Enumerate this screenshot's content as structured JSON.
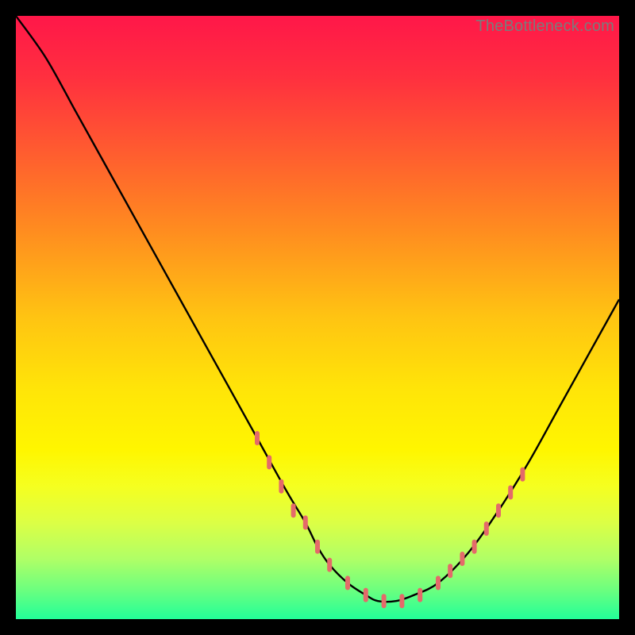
{
  "watermark": "TheBottleneck.com",
  "colors": {
    "gradient_stops": [
      {
        "offset": 0.0,
        "color": "#ff1749"
      },
      {
        "offset": 0.1,
        "color": "#ff2f3f"
      },
      {
        "offset": 0.22,
        "color": "#ff5a30"
      },
      {
        "offset": 0.35,
        "color": "#ff8a20"
      },
      {
        "offset": 0.5,
        "color": "#ffc412"
      },
      {
        "offset": 0.62,
        "color": "#ffe508"
      },
      {
        "offset": 0.72,
        "color": "#fff600"
      },
      {
        "offset": 0.78,
        "color": "#f5ff20"
      },
      {
        "offset": 0.84,
        "color": "#dcff45"
      },
      {
        "offset": 0.9,
        "color": "#b0ff66"
      },
      {
        "offset": 0.95,
        "color": "#6eff7e"
      },
      {
        "offset": 1.0,
        "color": "#22ff99"
      }
    ],
    "curve": "#000000",
    "marker": "#e46a6a",
    "frame_bg": "#000000"
  },
  "chart_data": {
    "type": "line",
    "title": "",
    "xlabel": "",
    "ylabel": "",
    "xlim": [
      0,
      100
    ],
    "ylim": [
      0,
      100
    ],
    "grid": false,
    "legend": false,
    "series": [
      {
        "name": "bottleneck-curve",
        "x": [
          0,
          5,
          10,
          15,
          20,
          25,
          30,
          35,
          40,
          45,
          48,
          50,
          52,
          55,
          58,
          60,
          63,
          66,
          70,
          75,
          80,
          85,
          90,
          95,
          100
        ],
        "y": [
          100,
          93,
          84,
          75,
          66,
          57,
          48,
          39,
          30,
          21,
          16,
          12,
          9,
          6,
          4,
          3,
          3,
          4,
          6,
          11,
          18,
          26,
          35,
          44,
          53
        ]
      }
    ],
    "markers": {
      "name": "highlight-dots",
      "x": [
        40,
        42,
        44,
        46,
        48,
        50,
        52,
        55,
        58,
        61,
        64,
        67,
        70,
        72,
        74,
        76,
        78,
        80,
        82,
        84
      ],
      "y": [
        30,
        26,
        22,
        18,
        16,
        12,
        9,
        6,
        4,
        3,
        3,
        4,
        6,
        8,
        10,
        12,
        15,
        18,
        21,
        24
      ]
    }
  }
}
